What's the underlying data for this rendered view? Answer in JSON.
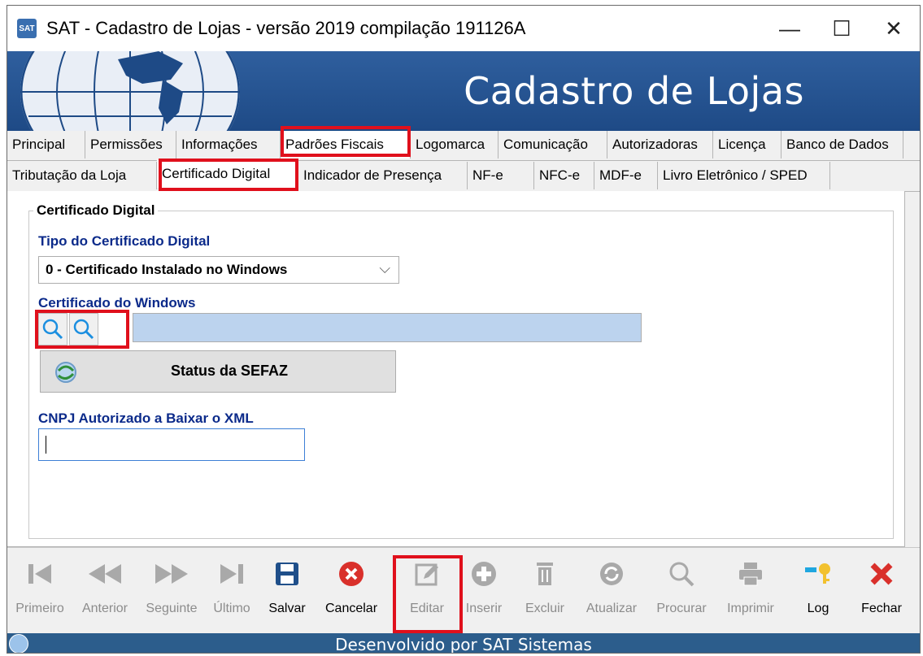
{
  "window": {
    "title": "SAT - Cadastro de Lojas - versão 2019 compilação 191126A",
    "icon_label": "SAT",
    "minimize_glyph": "—",
    "maximize_glyph": "☐",
    "close_glyph": "✕"
  },
  "banner": {
    "title": "Cadastro de Lojas"
  },
  "tabs_main": [
    {
      "label": "Principal"
    },
    {
      "label": "Permissões"
    },
    {
      "label": "Informações"
    },
    {
      "label": "Padrões Fiscais"
    },
    {
      "label": "Logomarca"
    },
    {
      "label": "Comunicação"
    },
    {
      "label": "Autorizadoras"
    },
    {
      "label": "Licença"
    },
    {
      "label": "Banco de Dados"
    }
  ],
  "tabs_sub": [
    {
      "label": "Tributação da Loja"
    },
    {
      "label": "Certificado Digital"
    },
    {
      "label": "Indicador de Presença"
    },
    {
      "label": "NF-e"
    },
    {
      "label": "NFC-e"
    },
    {
      "label": "MDF-e"
    },
    {
      "label": "Livro Eletrônico / SPED"
    }
  ],
  "certificado": {
    "group_title": "Certificado Digital",
    "tipo_label": "Tipo do Certificado Digital",
    "tipo_value": "0 - Certificado Instalado no Windows",
    "windows_label": "Certificado do Windows",
    "windows_value": "",
    "sefaz_button": "Status da SEFAZ",
    "cnpj_label": "CNPJ Autorizado a Baixar o XML",
    "cnpj_value": ""
  },
  "toolbar": {
    "primeiro": "Primeiro",
    "anterior": "Anterior",
    "seguinte": "Seguinte",
    "ultimo": "Último",
    "salvar": "Salvar",
    "cancelar": "Cancelar",
    "editar": "Editar",
    "inserir": "Inserir",
    "excluir": "Excluir",
    "atualizar": "Atualizar",
    "procurar": "Procurar",
    "imprimir": "Imprimir",
    "log": "Log",
    "fechar": "Fechar"
  },
  "status": {
    "text": "Desenvolvido por SAT Sistemas"
  },
  "colors": {
    "highlight": "#e0101c",
    "label_blue": "#0b2a8a",
    "banner": "#2f5f9e",
    "statusbar": "#2c5d8c"
  }
}
